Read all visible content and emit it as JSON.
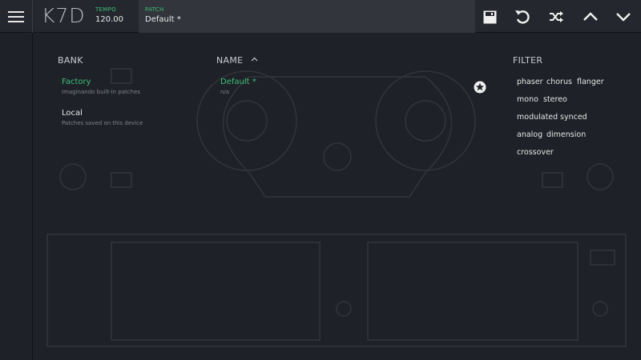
{
  "app": {
    "logo": "K7D"
  },
  "header": {
    "tempo_label": "TEMPO",
    "tempo_value": "120.00",
    "patch_label": "PATCH",
    "patch_value": "Default *",
    "icons": [
      "menu-icon",
      "save-icon",
      "undo-icon",
      "shuffle-icon",
      "chevron-up-icon",
      "chevron-down-icon"
    ]
  },
  "browser": {
    "bank_header": "BANK",
    "name_header": "NAME",
    "filter_header": "FILTER",
    "banks": [
      {
        "name": "Factory",
        "description": "Imaginando built-in patches",
        "selected": true
      },
      {
        "name": "Local",
        "description": "Patches saved on this device",
        "selected": false
      }
    ],
    "patches": [
      {
        "name": "Default *",
        "subtitle": "n/a",
        "selected": true
      }
    ],
    "filters": [
      "phaser",
      "chorus",
      "flanger",
      "mono",
      "stereo",
      "modulated",
      "synced",
      "analog",
      "dimension",
      "crossover"
    ]
  },
  "colors": {
    "accent": "#3fbf7a",
    "background": "#1e2127",
    "topbar": "#24272d",
    "patch_field": "#32353b"
  }
}
